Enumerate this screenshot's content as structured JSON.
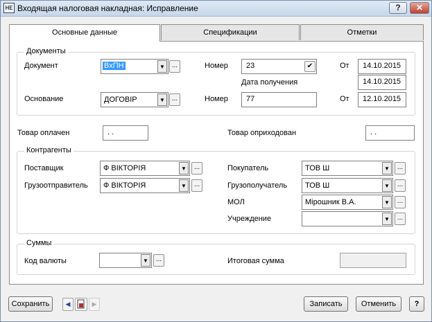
{
  "window": {
    "title": "Входящая налоговая накладная: Исправление",
    "app_icon": "НЕ",
    "help_glyph": "?",
    "close_glyph": "✕"
  },
  "tabs": [
    {
      "label": "Основные данные",
      "active": true
    },
    {
      "label": "Спецификации",
      "active": false
    },
    {
      "label": "Отметки",
      "active": false
    }
  ],
  "documents": {
    "group_title": "Документы",
    "document_label": "Документ",
    "document_value": "ВхПН",
    "basis_label": "Основание",
    "basis_value": "ДОГОВІР",
    "number_label": "Номер",
    "number_value": "23",
    "number2_label": "Номер",
    "number2_value": "77",
    "receipt_date_label": "Дата получения",
    "from_label": "От",
    "from_value": "14.10.2015",
    "receipt_date_value": "14.10.2015",
    "from2_label": "От",
    "from2_value": "12.10.2015"
  },
  "goods": {
    "paid_label": "Товар оплачен",
    "paid_value": ". .",
    "received_label": "Товар оприходован",
    "received_value": ". ."
  },
  "counterparties": {
    "group_title": "Контрагенты",
    "supplier_label": "Поставщик",
    "supplier_value": "Ф ВІКТОРІЯ",
    "shipper_label": "Грузоотправитель",
    "shipper_value": "Ф ВІКТОРІЯ",
    "buyer_label": "Покупатель",
    "buyer_value": "ТОВ Ш",
    "consignee_label": "Грузополучатель",
    "consignee_value": "ТОВ Ш",
    "mol_label": "МОЛ",
    "mol_value": "Мірошник В.А.",
    "institution_label": "Учреждение",
    "institution_value": ""
  },
  "sums": {
    "group_title": "Суммы",
    "currency_label": "Код валюты",
    "currency_value": "",
    "total_label": "Итоговая сумма",
    "total_value": ""
  },
  "footer": {
    "save_label": "Сохранить",
    "write_label": "Записать",
    "cancel_label": "Отменить",
    "help_label": "?"
  }
}
